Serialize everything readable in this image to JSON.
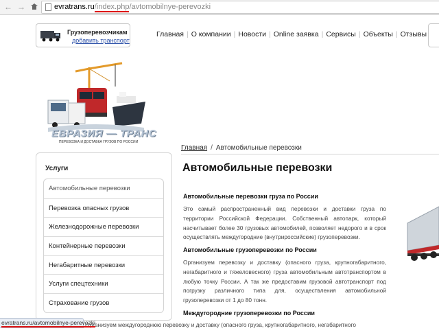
{
  "browser": {
    "url_host": "evratrans.ru",
    "url_path_highlight": "/index.php",
    "url_path_rest": "/avtomobilnye-perevozki",
    "status_url_host": "evratrans.ru",
    "status_url_path": "/avtomobilnye-perevozki"
  },
  "header": {
    "cargo_title": "Грузоперевозчикам",
    "cargo_link": "добавить транспорт",
    "nav": [
      "Главная",
      "О компании",
      "Новости",
      "Online заявка",
      "Сервисы",
      "Объекты",
      "Отзывы"
    ]
  },
  "logo": {
    "name": "ЕВРАЗИЯ — ТРАНС",
    "tagline": "ПЕРЕВОЗКА И ДОСТАВКА ГРУЗОВ ПО РОССИИ"
  },
  "breadcrumb": {
    "home": "Главная",
    "separator": "/",
    "current": "Автомобильные перевозки"
  },
  "sidebar": {
    "title": "Услуги",
    "items": [
      "Автомобильные перевозки",
      "Перевозка опасных грузов",
      "Железнодорожные перевозки",
      "Контейнерные перевозки",
      "Негабаритные перевозки",
      "Услуги спецтехники",
      "Страхование грузов"
    ]
  },
  "main": {
    "title": "Автомобильные перевозки",
    "sections": [
      {
        "heading": "Автомобильные перевозки груза по России",
        "text": "Это самый распространенный вид перевозки и доставки груза по территории Российской Федерации. Собственный автопарк, который насчитывает более 30 грузовых автомобилей, позволяет недорого и в срок осуществлять междугородние (внутрироссийские) грузоперевозки."
      },
      {
        "heading": "Автомобильные грузоперевозки по России",
        "text": "Организуем перевозку и доставку (опасного груза, крупногабаритного, негабаритного и тяжеловесного) груза автомобильным автотранспортом в любую точку России. А так же предоставим грузовой автотранспорт под погрузку различного типа для, осуществления автомобильной грузоперевозки от 1 до 80 тонн."
      },
      {
        "heading": "Междугородние грузоперевозки по России",
        "text": "Организуем междугороднюю перевозку и доставку (опасного груза, крупногабаритного, негабаритного"
      }
    ]
  },
  "colors": {
    "link": "#2a4fa8",
    "highlight_underline": "#dd1111",
    "logo_text": "#b8c6d6"
  }
}
